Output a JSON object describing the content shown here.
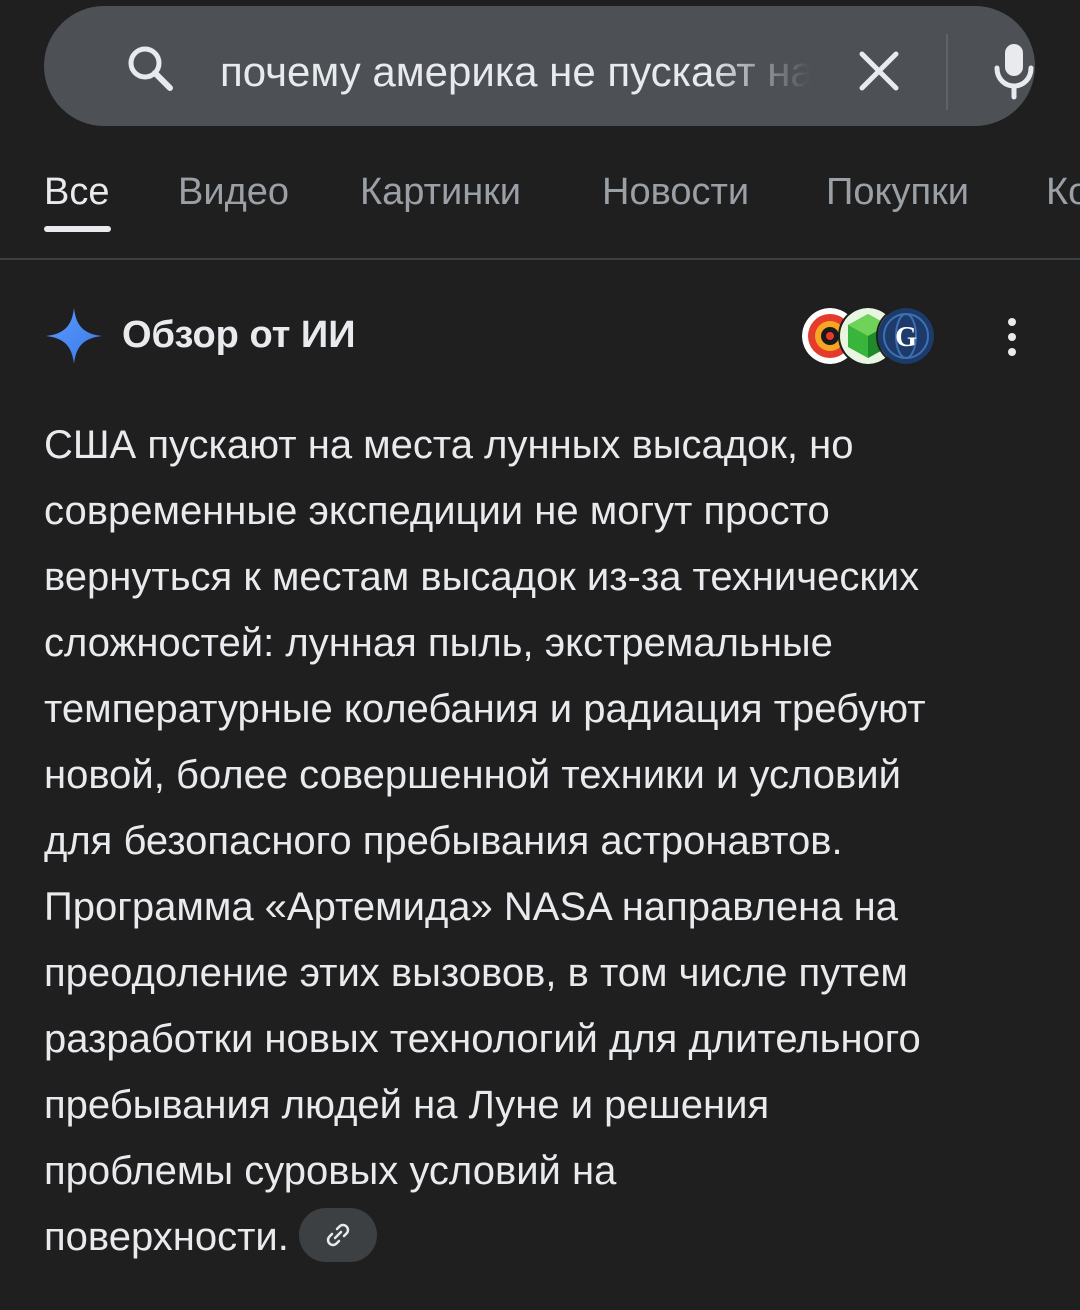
{
  "search": {
    "query": "почему америка не пускает на места лунных высадок"
  },
  "tabs": [
    {
      "label": "Все",
      "active": true
    },
    {
      "label": "Видео",
      "active": false
    },
    {
      "label": "Картинки",
      "active": false
    },
    {
      "label": "Новости",
      "active": false
    },
    {
      "label": "Покупки",
      "active": false
    },
    {
      "label": "Ко",
      "active": false
    }
  ],
  "ai_overview": {
    "title": "Обзор от ИИ",
    "answer_lines": [
      "США пускают на места лунных высадок, но",
      "современные экспедиции не могут просто",
      "вернуться к местам высадок из-за технических",
      "сложностей: лунная пыль, экстремальные",
      "температурные колебания и радиация требуют",
      "новой, более совершенной техники и условий",
      "для безопасного пребывания астронавтов.",
      "Программа «Артемида» NASA направлена на",
      "преодоление этих вызовов, в том числе путем",
      "разработки новых технологий для длительного",
      "пребывания людей на Луне и решения",
      "проблемы суровых условий на",
      "поверхности."
    ],
    "source_icons": [
      "target-logo-icon",
      "green-cube-logo-icon",
      "globe-g-logo-icon"
    ]
  },
  "colors": {
    "background": "#1f1f1f",
    "search_bar": "#4d5156",
    "text_primary": "#e8eaed",
    "text_secondary": "#9aa0a6",
    "chip": "#3c4043",
    "sparkle": "#4f8df5"
  }
}
